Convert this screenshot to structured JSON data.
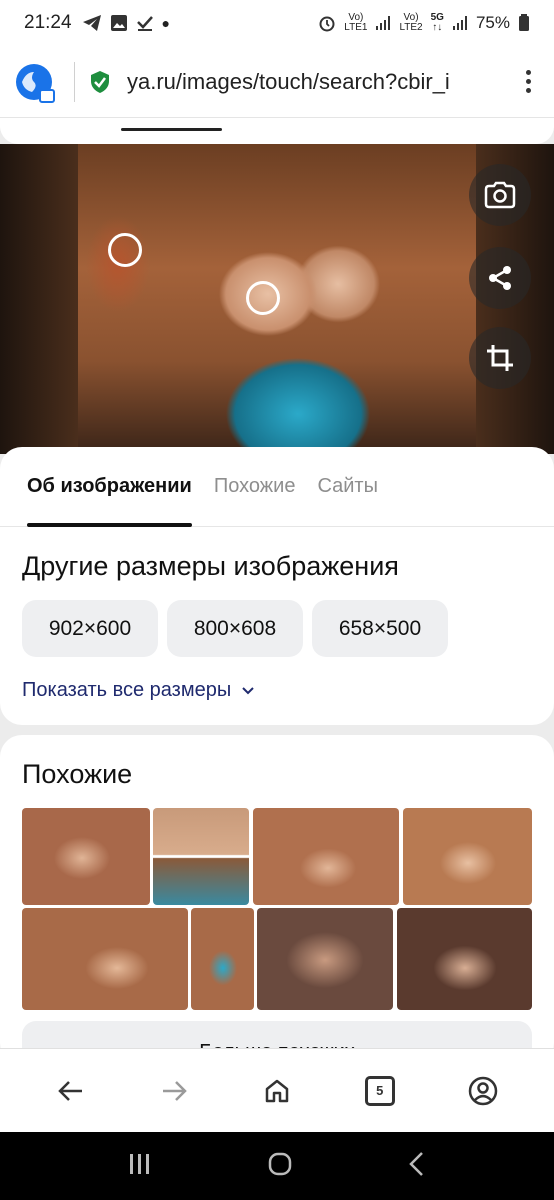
{
  "status_bar": {
    "time": "21:24",
    "sim1": "LTE1",
    "sim2": "LTE2",
    "network": "5G",
    "battery": "75%"
  },
  "browser": {
    "url": "ya.ru/images/touch/search?cbir_i"
  },
  "image_actions": [
    "camera-search-icon",
    "share-icon",
    "crop-icon"
  ],
  "tabs": [
    {
      "label": "Об изображении",
      "active": true
    },
    {
      "label": "Похожие",
      "active": false
    },
    {
      "label": "Сайты",
      "active": false
    }
  ],
  "other_sizes": {
    "title": "Другие размеры изображения",
    "sizes": [
      "902×600",
      "800×608",
      "658×500"
    ],
    "show_all": "Показать все размеры"
  },
  "similar": {
    "title": "Похожие",
    "more_button": "Больше похожих"
  },
  "browser_nav": {
    "tab_count": "5"
  },
  "colors": {
    "accent_teal": "#2ba9c9",
    "link": "#1f2a6e",
    "chip_bg": "#eeeff1"
  }
}
